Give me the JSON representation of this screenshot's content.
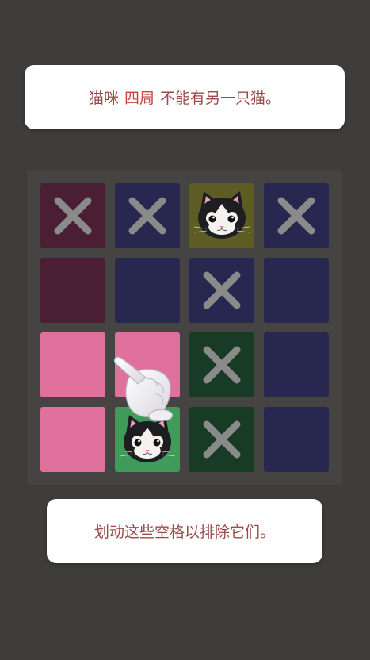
{
  "hint_top": {
    "before": "猫咪",
    "highlight": "四周",
    "after": "不能有另一只猫。"
  },
  "hint_bottom": {
    "text": "划动这些空格以排除它们。"
  },
  "colors": {
    "maroon": "#4a1f33",
    "navy": "#272750",
    "olive": "#5e5c25",
    "pink": "#e0719c",
    "dark_green": "#173b25",
    "green": "#3f9b5a",
    "x_mark": "#8a8a8a"
  },
  "board": {
    "rows": 4,
    "cols": 4,
    "cells": [
      {
        "region": "maroon",
        "content": "x"
      },
      {
        "region": "navy",
        "content": "x"
      },
      {
        "region": "olive",
        "content": "cat"
      },
      {
        "region": "navy",
        "content": "x"
      },
      {
        "region": "maroon",
        "content": "empty"
      },
      {
        "region": "navy",
        "content": "empty"
      },
      {
        "region": "navy",
        "content": "x"
      },
      {
        "region": "navy",
        "content": "empty"
      },
      {
        "region": "pink",
        "content": "empty"
      },
      {
        "region": "pink",
        "content": "empty"
      },
      {
        "region": "dark_green",
        "content": "x"
      },
      {
        "region": "navy",
        "content": "empty"
      },
      {
        "region": "pink",
        "content": "empty"
      },
      {
        "region": "green",
        "content": "cat"
      },
      {
        "region": "dark_green",
        "content": "x"
      },
      {
        "region": "navy",
        "content": "empty"
      }
    ]
  },
  "pointer": {
    "icon": "pointing-hand-icon"
  }
}
